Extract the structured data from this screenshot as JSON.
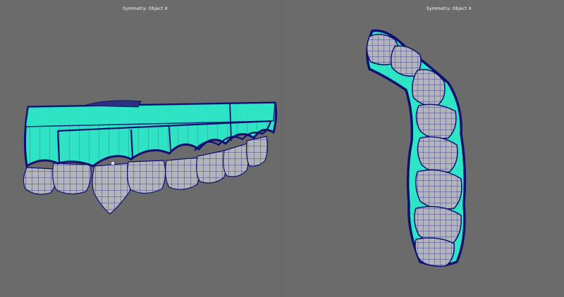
{
  "viewports": [
    {
      "label": "Symmetry: Object X"
    },
    {
      "label": "Symmetry: Object X"
    }
  ],
  "colors": {
    "background": "#6b6b6b",
    "gum": "#2ee5c6",
    "outline": "#0c1170",
    "tooth": "#b6b6bd",
    "wire": "#1e2a86"
  },
  "icons": [
    "front-view-teeth-mesh",
    "side-view-teeth-mesh"
  ]
}
